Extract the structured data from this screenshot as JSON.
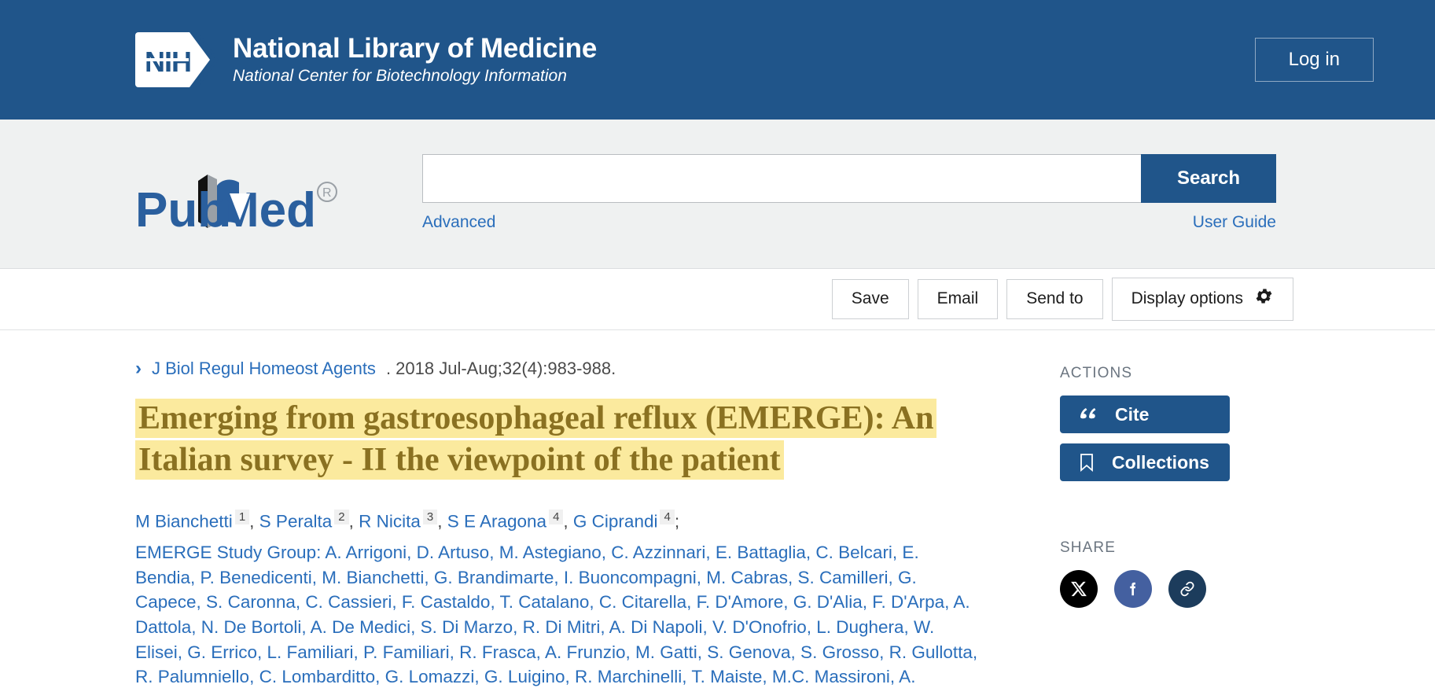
{
  "nih_header": {
    "logo_text": "NIH",
    "title": "National Library of Medicine",
    "subtitle": "National Center for Biotechnology Information",
    "login_label": "Log in",
    "background_color": "#20558a"
  },
  "pubmed_bar": {
    "logo_text": "PubMed",
    "registered_mark": "®",
    "search_value": "",
    "search_placeholder": "",
    "search_button_label": "Search",
    "advanced_link": "Advanced",
    "user_guide_link": "User Guide",
    "accent_color": "#20558a",
    "link_color": "#2a6ebb"
  },
  "toolbar": {
    "save_label": "Save",
    "email_label": "Email",
    "send_to_label": "Send to",
    "display_options_label": "Display options",
    "gear_icon": "gear-icon"
  },
  "article": {
    "chevron_icon": "chevron-right-icon",
    "journal": "J Biol Regul Homeost Agents",
    "citation_details": ". 2018 Jul-Aug;32(4):983-988.",
    "title": "Emerging from gastroesophageal reflux (EMERGE): An Italian survey - II the viewpoint of the patient",
    "title_highlight_color": "#fbea9e",
    "title_text_color": "#8a7121",
    "authors": [
      {
        "name": "M Bianchetti",
        "affiliation": "1"
      },
      {
        "name": "S Peralta",
        "affiliation": "2"
      },
      {
        "name": "R Nicita",
        "affiliation": "3"
      },
      {
        "name": "S E Aragona",
        "affiliation": "4"
      },
      {
        "name": "G Ciprandi",
        "affiliation": "4"
      }
    ],
    "collaborators_label": "EMERGE Study Group:",
    "collaborators": "A. Arrigoni, D. Artuso, M. Astegiano, C. Azzinnari, E. Battaglia, C. Belcari, E. Bendia, P. Benedicenti, M. Bianchetti, G. Brandimarte, I. Buoncompagni, M. Cabras, S. Camilleri, G. Capece, S. Caronna, C. Cassieri, F. Castaldo, T. Catalano, C. Citarella, F. D'Amore, G. D'Alia, F. D'Arpa, A. Dattola, N. De Bortoli, A. De Medici, S. Di Marzo, R. Di Mitri, A. Di Napoli, V. D'Onofrio, L. Dughera, W. Elisei, G. Errico, L. Familiari, P. Familiari, R. Frasca, A. Frunzio, M. Gatti, S. Genova, S. Grosso, R. Gullotta, R. Palumniello, C. Lombarditto, G. Lomazzi, G. Luigino, R. Marchinelli, T. Maiste, M.C. Massironi, A."
  },
  "sidebar": {
    "actions_heading": "ACTIONS",
    "cite_label": "Cite",
    "cite_icon": "quote-icon",
    "collections_label": "Collections",
    "collections_icon": "bookmark-icon",
    "share_heading": "SHARE",
    "share_buttons": [
      {
        "name": "twitter-x-icon",
        "color": "#000000"
      },
      {
        "name": "facebook-icon",
        "color": "#4460a0"
      },
      {
        "name": "permalink-icon",
        "color": "#1c3c5c"
      }
    ]
  }
}
